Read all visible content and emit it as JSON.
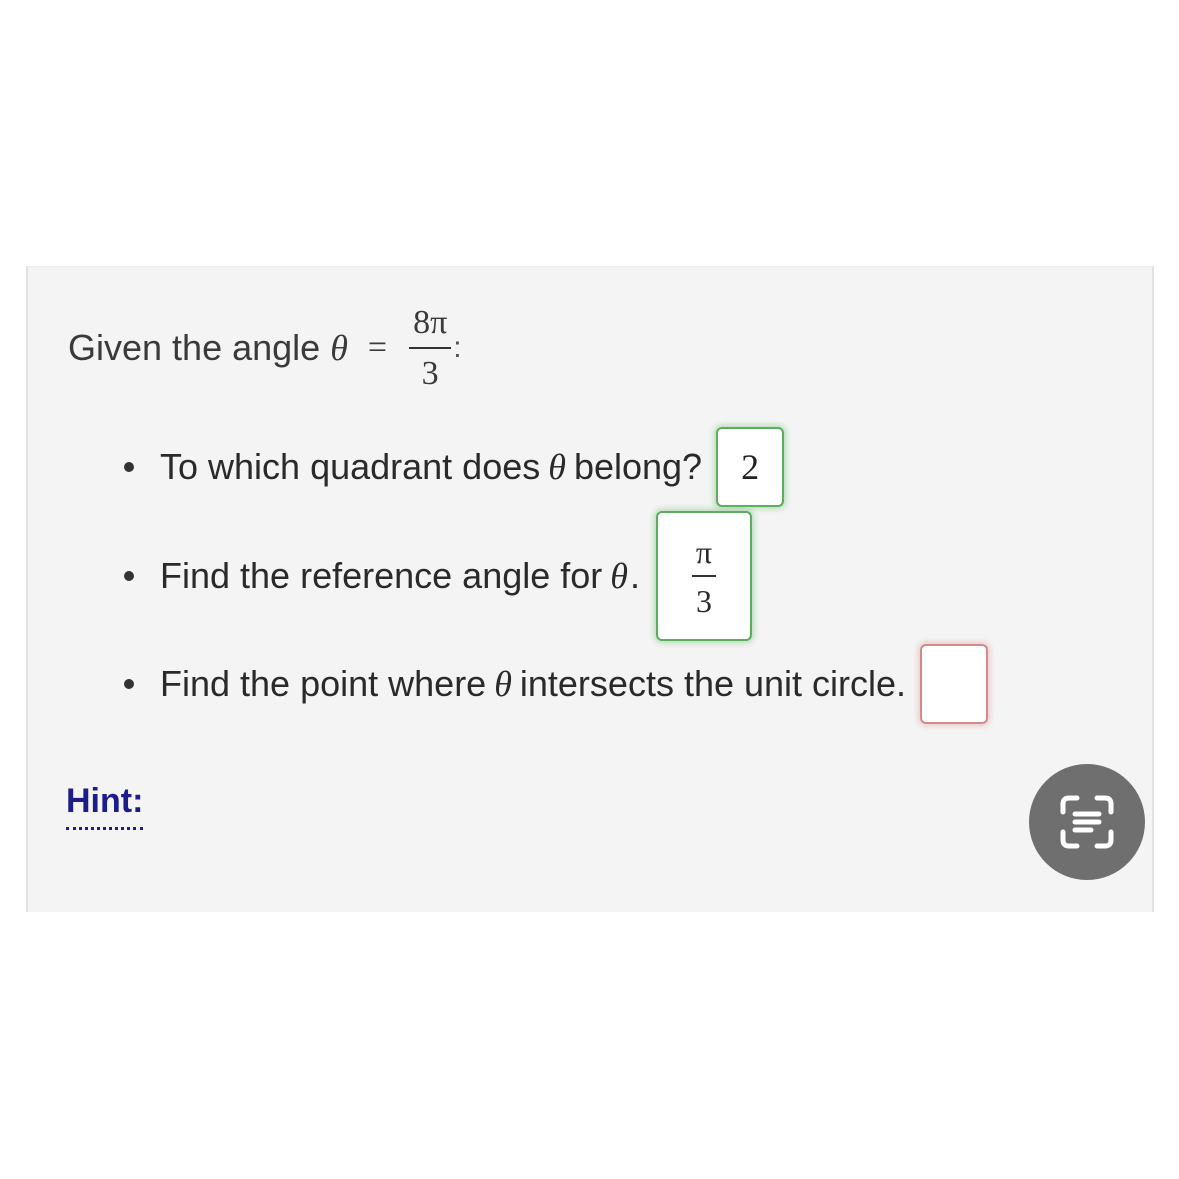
{
  "prompt": {
    "lead": "Given the angle",
    "symbol": "θ",
    "equals": "=",
    "angle_num": "8π",
    "angle_den": "3",
    "trail": ":"
  },
  "questions": [
    {
      "text_before": "To which quadrant does",
      "symbol": "θ",
      "text_after": "belong?",
      "answer": "2",
      "status": "correct"
    },
    {
      "text_before": "Find the reference angle for",
      "symbol": "θ",
      "text_after": ".",
      "answer_num": "π",
      "answer_den": "3",
      "status": "correct"
    },
    {
      "text_before": "Find the point where",
      "symbol": "θ",
      "text_after": "intersects the unit circle.",
      "answer": "",
      "status": "empty"
    }
  ],
  "hint": {
    "label": "Hint:"
  },
  "scan_button": {
    "icon": "text-scan-icon"
  },
  "colors": {
    "correct": "#5cae5c",
    "empty": "#d58a8a",
    "hint": "#1c1c8a",
    "panel": "#f4f4f4"
  }
}
